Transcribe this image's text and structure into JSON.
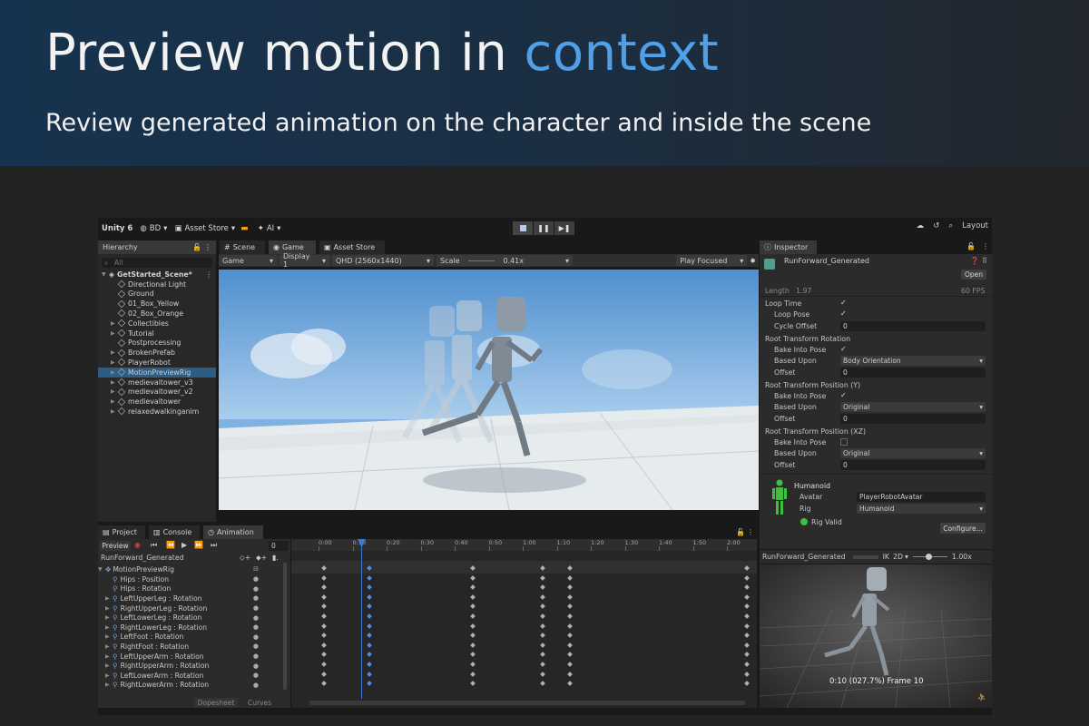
{
  "banner": {
    "headline_prefix": "Preview motion in ",
    "headline_accent": "context",
    "subhead": "Review generated animation on the character and inside the scene"
  },
  "toolbar": {
    "unity": "Unity 6",
    "account": "BD",
    "asset_store": "Asset Store",
    "ai": "AI",
    "layout": "Layout"
  },
  "hierarchy": {
    "tab": "Hierarchy",
    "search": "All",
    "scene": "GetStarted_Scene*",
    "items": [
      "Directional Light",
      "Ground",
      "01_Box_Yellow",
      "02_Box_Orange",
      "Collectibles",
      "Tutorial",
      "Postprocessing",
      "BrokenPrefab",
      "PlayerRobot",
      "MotionPreviewRig",
      "medievaltower_v3",
      "medievaltower_v2",
      "medievaltower",
      "relaxedwalkinganim"
    ]
  },
  "view_tabs": {
    "scene": "Scene",
    "game": "Game",
    "asset_store": "Asset Store"
  },
  "game_bar": {
    "mode": "Game",
    "display": "Display 1",
    "resolution": "QHD (2560x1440)",
    "scale_label": "Scale",
    "scale_value": "0.41x",
    "play_focused": "Play Focused"
  },
  "inspector": {
    "tab": "Inspector",
    "asset": "RunForward_Generated",
    "open": "Open",
    "length_label": "Length",
    "length_value": "1.97",
    "fps": "60 FPS",
    "loop_time": "Loop Time",
    "loop_pose": "Loop Pose",
    "cycle_offset": "Cycle Offset",
    "cycle_offset_value": "0",
    "rtr": "Root Transform Rotation",
    "bake": "Bake Into Pose",
    "based_upon": "Based Upon",
    "offset": "Offset",
    "offset_value": "0",
    "rtr_based": "Body Orientation",
    "rty": "Root Transform Position (Y)",
    "rty_based": "Original",
    "rtxz": "Root Transform Position (XZ)",
    "rtxz_based": "Original",
    "humanoid": "Humanoid",
    "avatar_label": "Avatar",
    "avatar_value": "PlayerRobotAvatar",
    "rig_label": "Rig",
    "rig_value": "Humanoid",
    "rig_valid": "Rig Valid",
    "configure": "Configure..."
  },
  "preview": {
    "clip": "RunForward_Generated",
    "ik": "IK",
    "mode": "2D",
    "speed": "1.00x",
    "status": "0:10 (027.7%) Frame 10"
  },
  "bottom_tabs": {
    "project": "Project",
    "console": "Console",
    "animation": "Animation"
  },
  "animation": {
    "preview": "Preview",
    "frame": "0",
    "clip": "RunForward_Generated",
    "rig": "MotionPreviewRig",
    "tracks": [
      "Hips : Position",
      "Hips : Rotation",
      "LeftUpperLeg : Rotation",
      "RightUpperLeg : Rotation",
      "LeftLowerLeg : Rotation",
      "RightLowerLeg : Rotation",
      "LeftFoot : Rotation",
      "RightFoot : Rotation",
      "LeftUpperArm : Rotation",
      "RightUpperArm : Rotation",
      "LeftLowerArm : Rotation",
      "RightLowerArm : Rotation"
    ],
    "dopesheet": "Dopesheet",
    "curves": "Curves",
    "ticks": [
      "0:00",
      "0:10",
      "0:20",
      "0:30",
      "0:40",
      "0:50",
      "1:00",
      "1:10",
      "1:20",
      "1:30",
      "1:40",
      "1:50",
      "2:00"
    ]
  },
  "colors": {
    "accent": "#4fa0e8",
    "selection": "#2c5d87",
    "rig_valid": "#3fbf3f"
  }
}
